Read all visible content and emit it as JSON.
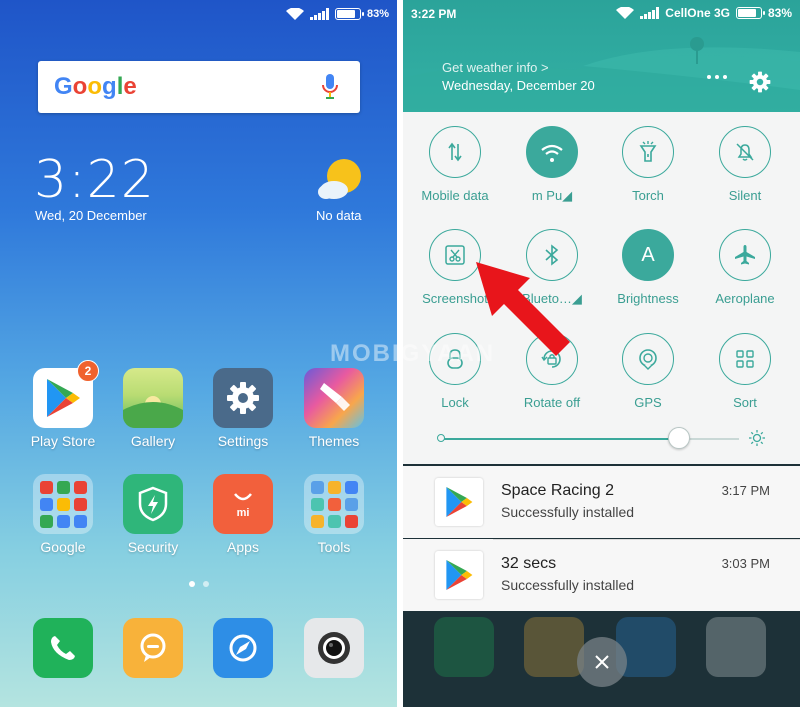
{
  "home": {
    "status": {
      "battery": "83%"
    },
    "search": {
      "logo_letters": [
        "G",
        "o",
        "o",
        "g",
        "l",
        "e"
      ]
    },
    "clock": {
      "time": "3:22",
      "date": "Wed, 20 December"
    },
    "weather": {
      "label": "No data"
    },
    "apps": [
      {
        "label": "Play Store",
        "icon": "play-store-icon",
        "badge": "2"
      },
      {
        "label": "Gallery",
        "icon": "gallery-icon"
      },
      {
        "label": "Settings",
        "icon": "gear-icon"
      },
      {
        "label": "Themes",
        "icon": "brush-icon"
      },
      {
        "label": "Google",
        "icon": "google-folder-icon"
      },
      {
        "label": "Security",
        "icon": "shield-icon"
      },
      {
        "label": "Apps",
        "icon": "mi-store-icon"
      },
      {
        "label": "Tools",
        "icon": "tools-folder-icon"
      }
    ],
    "dock": [
      "phone-icon",
      "message-icon",
      "browser-icon",
      "camera-icon"
    ],
    "page_indicator": {
      "pages": 2,
      "current": 1
    }
  },
  "shade": {
    "status": {
      "time": "3:22 PM",
      "carrier": "CellOne 3G",
      "battery": "83%"
    },
    "weather_link": "Get weather info >",
    "date": "Wednesday, December 20",
    "tiles": [
      {
        "label": "Mobile data",
        "icon": "mobile-data-icon",
        "on": false
      },
      {
        "label": "m    Pu◢",
        "icon": "wifi-icon",
        "on": true
      },
      {
        "label": "Torch",
        "icon": "torch-icon",
        "on": false
      },
      {
        "label": "Silent",
        "icon": "bell-off-icon",
        "on": false
      },
      {
        "label": "Screenshot",
        "icon": "screenshot-icon",
        "on": false
      },
      {
        "label": "Blueto…◢",
        "icon": "bluetooth-icon",
        "on": false
      },
      {
        "label": "Brightness",
        "icon": "brightness-auto-icon",
        "on": true,
        "glyph": "A"
      },
      {
        "label": "Aeroplane",
        "icon": "airplane-icon",
        "on": false
      },
      {
        "label": "Lock",
        "icon": "lock-icon",
        "on": false
      },
      {
        "label": "Rotate off",
        "icon": "rotate-lock-icon",
        "on": false
      },
      {
        "label": "GPS",
        "icon": "gps-icon",
        "on": false
      },
      {
        "label": "Sort",
        "icon": "grid-icon",
        "on": false
      }
    ],
    "brightness": {
      "level": 0.8
    },
    "notifications": [
      {
        "title": "Space Racing 2",
        "subtitle": "Successfully installed",
        "time": "3:17 PM"
      },
      {
        "title": "32 secs",
        "subtitle": "Successfully installed",
        "time": "3:03 PM"
      }
    ],
    "close_icon": "close-icon"
  },
  "watermark": "MOBIGYAAN",
  "colors": {
    "accent": "#3ba99c",
    "arrow": "#e8151b",
    "badge": "#f0622e"
  }
}
